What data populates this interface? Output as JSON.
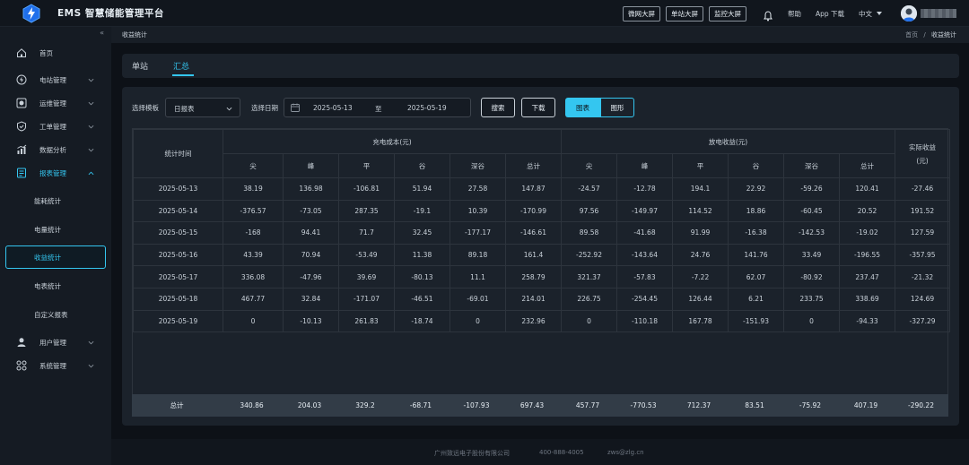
{
  "header": {
    "app_title": "EMS 智慧储能管理平台",
    "screen_buttons": [
      "微网大屏",
      "单站大屏",
      "监控大屏"
    ],
    "help": "帮助",
    "app_download": "App 下载",
    "language": "中文"
  },
  "sidebar": {
    "collapse_icon": "«",
    "items": [
      {
        "label": "首页",
        "icon": "home-icon"
      },
      {
        "label": "电站管理",
        "icon": "station-icon"
      },
      {
        "label": "运维管理",
        "icon": "maintenance-icon"
      },
      {
        "label": "工单管理",
        "icon": "workorder-icon"
      },
      {
        "label": "数据分析",
        "icon": "analysis-icon"
      },
      {
        "label": "报表管理",
        "icon": "report-icon"
      },
      {
        "label": "用户管理",
        "icon": "user-icon"
      },
      {
        "label": "系统管理",
        "icon": "system-icon"
      }
    ],
    "report_subitems": [
      "能耗统计",
      "电量统计",
      "收益统计",
      "电表统计",
      "自定义报表"
    ],
    "selected_subitem": "收益统计"
  },
  "breadcrumb": {
    "title": "收益统计",
    "home": "首页",
    "separator": "/",
    "current": "收益统计"
  },
  "tabs": [
    "单站",
    "汇总"
  ],
  "active_tab": "汇总",
  "filters": {
    "template_label": "选择模板",
    "template_value": "日报表",
    "date_label": "选择日期",
    "start_date": "2025-05-13",
    "to": "至",
    "end_date": "2025-05-19",
    "search_button": "搜索",
    "download_button": "下载",
    "view_table": "图表",
    "view_chart": "图形"
  },
  "table": {
    "col_time": "统计时间",
    "group_charge": "充电成本(元)",
    "group_discharge": "放电收益(元)",
    "col_actual_line1": "实际收益",
    "col_actual_line2": "(元)",
    "sub_headers": [
      "尖",
      "峰",
      "平",
      "谷",
      "深谷",
      "总计",
      "尖",
      "峰",
      "平",
      "谷",
      "深谷",
      "总计"
    ],
    "rows": [
      [
        "2025-05-13",
        "38.19",
        "136.98",
        "-106.81",
        "51.94",
        "27.58",
        "147.87",
        "-24.57",
        "-12.78",
        "194.1",
        "22.92",
        "-59.26",
        "120.41",
        "-27.46"
      ],
      [
        "2025-05-14",
        "-376.57",
        "-73.05",
        "287.35",
        "-19.1",
        "10.39",
        "-170.99",
        "97.56",
        "-149.97",
        "114.52",
        "18.86",
        "-60.45",
        "20.52",
        "191.52"
      ],
      [
        "2025-05-15",
        "-168",
        "94.41",
        "71.7",
        "32.45",
        "-177.17",
        "-146.61",
        "89.58",
        "-41.68",
        "91.99",
        "-16.38",
        "-142.53",
        "-19.02",
        "127.59"
      ],
      [
        "2025-05-16",
        "43.39",
        "70.94",
        "-53.49",
        "11.38",
        "89.18",
        "161.4",
        "-252.92",
        "-143.64",
        "24.76",
        "141.76",
        "33.49",
        "-196.55",
        "-357.95"
      ],
      [
        "2025-05-17",
        "336.08",
        "-47.96",
        "39.69",
        "-80.13",
        "11.1",
        "258.79",
        "321.37",
        "-57.83",
        "-7.22",
        "62.07",
        "-80.92",
        "237.47",
        "-21.32"
      ],
      [
        "2025-05-18",
        "467.77",
        "32.84",
        "-171.07",
        "-46.51",
        "-69.01",
        "214.01",
        "226.75",
        "-254.45",
        "126.44",
        "6.21",
        "233.75",
        "338.69",
        "124.69"
      ],
      [
        "2025-05-19",
        "0",
        "-10.13",
        "261.83",
        "-18.74",
        "0",
        "232.96",
        "0",
        "-110.18",
        "167.78",
        "-151.93",
        "0",
        "-94.33",
        "-327.29"
      ]
    ],
    "total": [
      "总计",
      "340.86",
      "204.03",
      "329.2",
      "-68.71",
      "-107.93",
      "697.43",
      "457.77",
      "-770.53",
      "712.37",
      "83.51",
      "-75.92",
      "407.19",
      "-290.22"
    ]
  },
  "footer": {
    "company": "广州致远电子股份有限公司",
    "phone": "400-888-4005",
    "email": "zws@zlg.cn"
  }
}
